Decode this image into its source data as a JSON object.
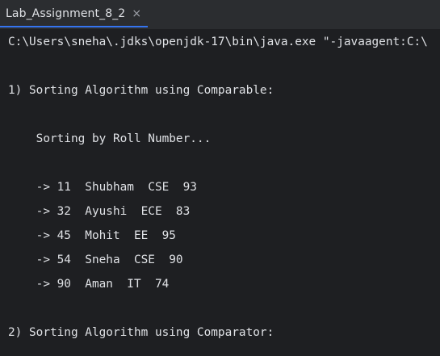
{
  "tab": {
    "label": "Lab_Assignment_8_2",
    "close_icon": "×"
  },
  "colors": {
    "background": "#1e1f22",
    "tabbar": "#2b2d30",
    "text": "#dfe1e5",
    "accent": "#3574f0"
  },
  "console": {
    "command": "C:\\Users\\sneha\\.jdks\\openjdk-17\\bin\\java.exe \"-javaagent:C:\\",
    "section1_title": "1) Sorting Algorithm using Comparable:",
    "sorting_message": "    Sorting by Roll Number...",
    "rows": [
      "    -> 11  Shubham  CSE  93",
      "    -> 32  Ayushi  ECE  83",
      "    -> 45  Mohit  EE  95",
      "    -> 54  Sneha  CSE  90",
      "    -> 90  Aman  IT  74"
    ],
    "section2_title": "2) Sorting Algorithm using Comparator:"
  }
}
